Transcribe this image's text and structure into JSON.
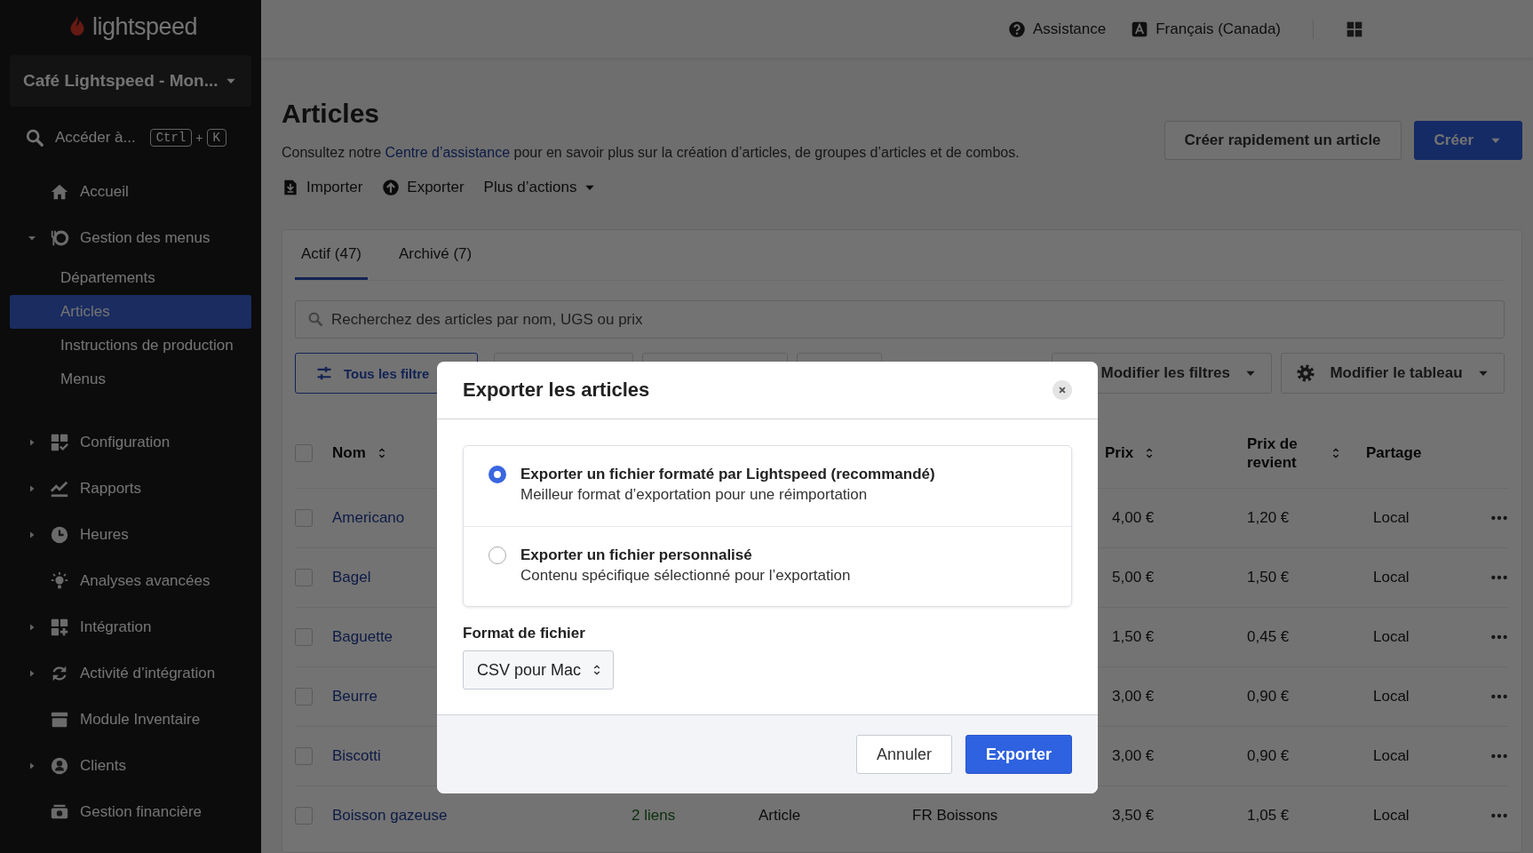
{
  "sidebar": {
    "logo": "lightspeed",
    "store": "Café Lightspeed - Mon...",
    "search": {
      "label": "Accéder à...",
      "keys": [
        "Ctrl",
        "K"
      ],
      "key_separator": "+"
    },
    "items": [
      {
        "label": "Accueil",
        "kind": "link"
      },
      {
        "label": "Gestion des menus",
        "kind": "group",
        "expanded": true,
        "children": [
          {
            "label": "Départements",
            "selected": false
          },
          {
            "label": "Articles",
            "selected": true
          },
          {
            "label": "Instructions de production",
            "selected": false
          },
          {
            "label": "Menus",
            "selected": false
          }
        ]
      },
      {
        "label": "Configuration",
        "kind": "group",
        "expanded": false
      },
      {
        "label": "Rapports",
        "kind": "group",
        "expanded": false
      },
      {
        "label": "Heures",
        "kind": "group",
        "expanded": false
      },
      {
        "label": "Analyses avancées",
        "kind": "link"
      },
      {
        "label": "Intégration",
        "kind": "group",
        "expanded": false
      },
      {
        "label": "Activité d’intégration",
        "kind": "group",
        "expanded": false
      },
      {
        "label": "Module Inventaire",
        "kind": "link"
      },
      {
        "label": "Clients",
        "kind": "group",
        "expanded": false
      },
      {
        "label": "Gestion financière",
        "kind": "link"
      }
    ]
  },
  "header": {
    "links": [
      "Assistance",
      "Français (Canada)"
    ]
  },
  "page": {
    "title": "Articles",
    "description": {
      "before": "Consultez notre ",
      "link": "Centre d’assistance",
      "after": " pour en savoir plus sur la création d’articles, de groupes d’articles et de combos."
    },
    "actions": [
      "Importer",
      "Exporter",
      "Plus d’actions"
    ],
    "buttons": [
      {
        "label": "Créer rapidement un article",
        "kind": "secondary"
      },
      {
        "label": "Créer",
        "kind": "primary"
      }
    ]
  },
  "tabs": [
    {
      "label": "Actif (47)",
      "selected": true
    },
    {
      "label": "Archivé (7)",
      "selected": false
    }
  ],
  "search": {
    "placeholder": "Recherchez des articles par nom, UGS ou prix"
  },
  "filters": {
    "all": "Tous les filtre",
    "edit_filters": "Modifier les filtres",
    "edit_table": "Modifier le tableau"
  },
  "table": {
    "select_all_checked": false,
    "columns": [
      {
        "label": "Nom",
        "sortable": true
      },
      {
        "label": "Prix",
        "sortable": true
      },
      {
        "label": "Prix de revient",
        "sortable": true
      },
      {
        "label": "Partage",
        "sortable": false
      }
    ],
    "rows": [
      {
        "name": "Americano",
        "price": "4,00 €",
        "cost": "1,20 €",
        "sharing": "Local",
        "checked": false
      },
      {
        "name": "Bagel",
        "price": "5,00 €",
        "cost": "1,50 €",
        "sharing": "Local",
        "checked": false
      },
      {
        "name": "Baguette",
        "price": "1,50 €",
        "cost": "0,45 €",
        "sharing": "Local",
        "checked": false
      },
      {
        "name": "Beurre",
        "price": "3,00 €",
        "cost": "0,90 €",
        "sharing": "Local",
        "checked": false
      },
      {
        "name": "Biscotti",
        "price": "3,00 €",
        "cost": "0,90 €",
        "sharing": "Local",
        "checked": false
      },
      {
        "name": "Boisson gazeuse",
        "column_3": "2 liens",
        "column_4": "Article",
        "column_5": "FR Boissons",
        "price": "3,50 €",
        "cost": "1,05 €",
        "sharing": "Local",
        "checked": false
      }
    ]
  },
  "modal": {
    "title": "Exporter les articles",
    "options": [
      {
        "title": "Exporter un fichier formaté par Lightspeed (recommandé)",
        "description": "Meilleur format d’exportation pour une réimportation",
        "selected": true
      },
      {
        "title": "Exporter un fichier personnalisé",
        "description": "Contenu spécifique sélectionné pour l’exportation",
        "selected": false
      }
    ],
    "format": {
      "label": "Format de fichier",
      "value": "CSV pour Mac"
    },
    "buttons": [
      {
        "label": "Annuler",
        "kind": "secondary"
      },
      {
        "label": "Exporter",
        "kind": "primary"
      }
    ]
  }
}
